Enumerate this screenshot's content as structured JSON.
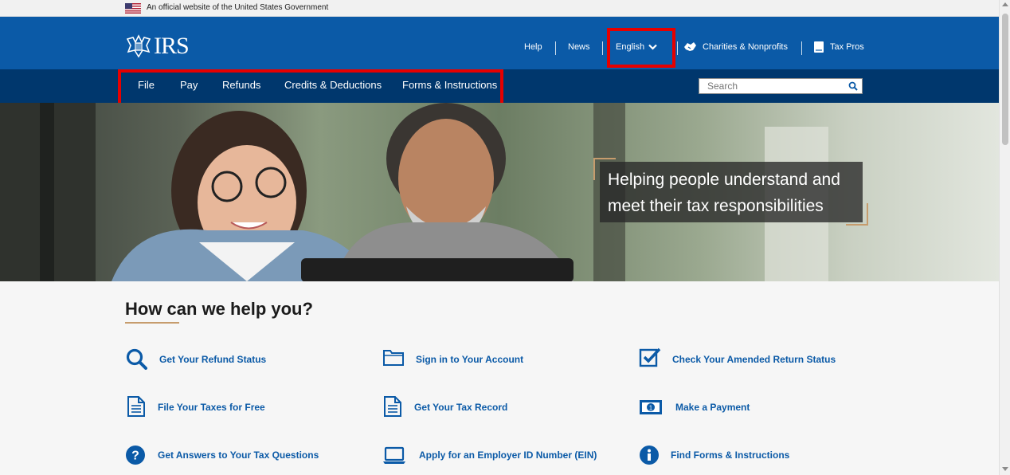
{
  "gov_banner": {
    "text": "An official website of the United States Government"
  },
  "header": {
    "logo_text": "IRS",
    "utility_nav": [
      "Help",
      "News"
    ],
    "language": "English",
    "charities": "Charities & Nonprofits",
    "tax_pros": "Tax Pros"
  },
  "main_nav": [
    "File",
    "Pay",
    "Refunds",
    "Credits & Deductions",
    "Forms & Instructions"
  ],
  "search": {
    "placeholder": "Search"
  },
  "hero": {
    "caption": "Helping people understand and meet their tax responsibilities"
  },
  "help": {
    "title": "How can we help you?",
    "tasks": [
      {
        "label": "Get Your Refund Status",
        "icon": "magnifier-icon"
      },
      {
        "label": "Sign in to Your Account",
        "icon": "folder-icon"
      },
      {
        "label": "Check Your Amended Return Status",
        "icon": "checkbox-icon"
      },
      {
        "label": "File Your Taxes for Free",
        "icon": "document-icon"
      },
      {
        "label": "Get Your Tax Record",
        "icon": "document-icon"
      },
      {
        "label": "Make a Payment",
        "icon": "money-icon"
      },
      {
        "label": "Get Answers to Your Tax Questions",
        "icon": "question-icon"
      },
      {
        "label": "Apply for an Employer ID Number (EIN)",
        "icon": "laptop-icon"
      },
      {
        "label": "Find Forms & Instructions",
        "icon": "info-icon"
      }
    ]
  },
  "colors": {
    "brand_blue": "#0b5aa7",
    "nav_dark": "#00376d",
    "accent_gold": "#c69c6d",
    "highlight_red": "#e60000"
  }
}
